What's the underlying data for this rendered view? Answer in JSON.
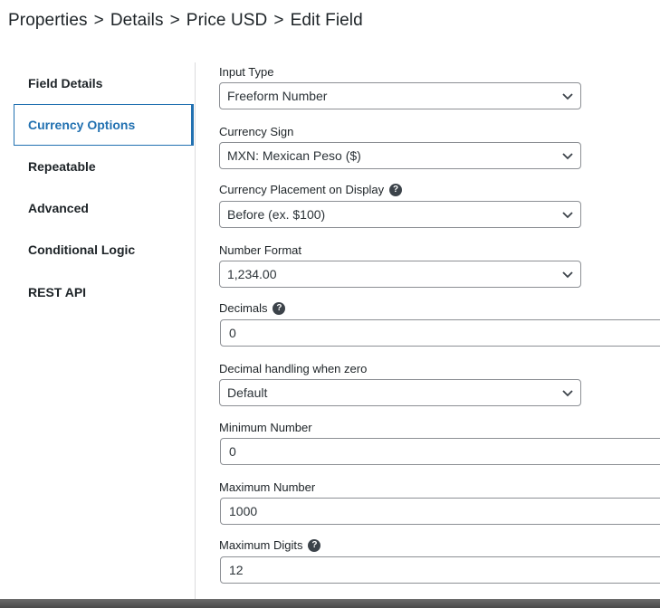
{
  "breadcrumb": {
    "items": [
      "Properties",
      "Details",
      "Price USD",
      "Edit Field"
    ],
    "separator": ">"
  },
  "sidebar": {
    "items": [
      {
        "label": "Field Details",
        "active": false
      },
      {
        "label": "Currency Options",
        "active": true
      },
      {
        "label": "Repeatable",
        "active": false
      },
      {
        "label": "Advanced",
        "active": false
      },
      {
        "label": "Conditional Logic",
        "active": false
      },
      {
        "label": "REST API",
        "active": false
      }
    ]
  },
  "fields": {
    "input_type": {
      "label": "Input Type",
      "value": "Freeform Number"
    },
    "currency_sign": {
      "label": "Currency Sign",
      "value": "MXN: Mexican Peso ($)"
    },
    "currency_placement": {
      "label": "Currency Placement on Display",
      "value": "Before (ex. $100)",
      "help": "?"
    },
    "number_format": {
      "label": "Number Format",
      "value": "1,234.00"
    },
    "decimals": {
      "label": "Decimals",
      "value": "0",
      "help": "?"
    },
    "decimal_zero": {
      "label": "Decimal handling when zero",
      "value": "Default"
    },
    "min_number": {
      "label": "Minimum Number",
      "value": "0"
    },
    "max_number": {
      "label": "Maximum Number",
      "value": "1000"
    },
    "max_digits": {
      "label": "Maximum Digits",
      "value": "12",
      "help": "?"
    }
  },
  "colors": {
    "accent": "#2271b1",
    "text": "#1d2327",
    "border": "#8c8f94"
  },
  "icons": {
    "dropdown": "chevron-down-icon",
    "help": "question-circle-icon"
  }
}
